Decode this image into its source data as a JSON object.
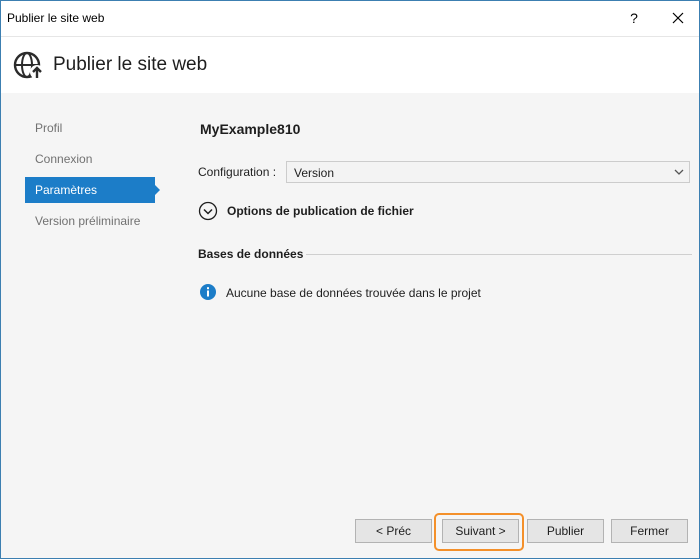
{
  "window": {
    "title": "Publier le site web",
    "help_label": "?"
  },
  "header": {
    "title": "Publier le site web",
    "icon": "globe-publish-icon"
  },
  "nav": {
    "items": [
      {
        "label": "Profil",
        "active": false
      },
      {
        "label": "Connexion",
        "active": false
      },
      {
        "label": "Paramètres",
        "active": true
      },
      {
        "label": "Version préliminaire",
        "active": false
      }
    ]
  },
  "content": {
    "profile_name": "MyExample810",
    "configuration_label": "Configuration :",
    "configuration_value": "Version",
    "options_label": "Options de publication de fichier",
    "databases_label": "Bases de données",
    "info_text": "Aucune base de données trouvée dans le projet"
  },
  "buttons": {
    "prev": "< Préc",
    "next": "Suivant >",
    "publish": "Publier",
    "close": "Fermer"
  },
  "colors": {
    "accent": "#1c7dc8",
    "highlight": "#f4902a",
    "body_bg": "#f5f5f5"
  }
}
